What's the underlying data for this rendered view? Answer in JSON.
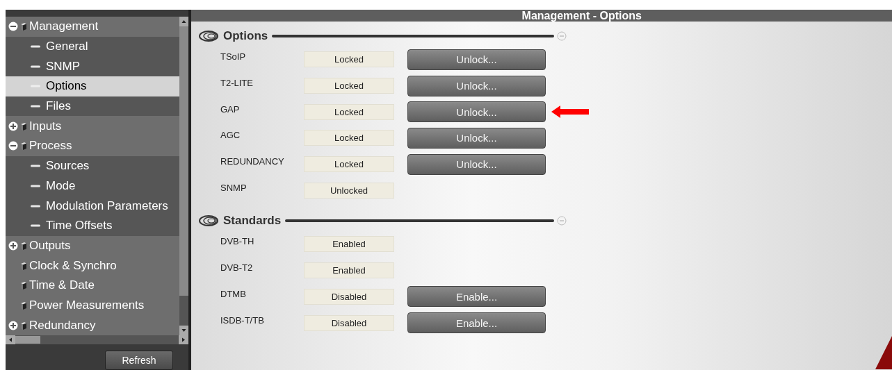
{
  "header": {
    "title": "Management - Options"
  },
  "tree": [
    {
      "label": "Management",
      "expanded": true,
      "selected": false,
      "children": [
        {
          "label": "General",
          "selected": false
        },
        {
          "label": "SNMP",
          "selected": false
        },
        {
          "label": "Options",
          "selected": true
        },
        {
          "label": "Files",
          "selected": false
        }
      ]
    },
    {
      "label": "Inputs",
      "expanded": false,
      "selected": false
    },
    {
      "label": "Process",
      "expanded": true,
      "selected": false,
      "children": [
        {
          "label": "Sources",
          "selected": false
        },
        {
          "label": "Mode",
          "selected": false
        },
        {
          "label": "Modulation Parameters",
          "selected": false
        },
        {
          "label": "Time Offsets",
          "selected": false
        }
      ]
    },
    {
      "label": "Outputs",
      "expanded": false,
      "selected": false
    },
    {
      "label": "Clock & Synchro",
      "selected": false
    },
    {
      "label": "Time & Date",
      "selected": false
    },
    {
      "label": "Power Measurements",
      "selected": false
    },
    {
      "label": "Redundancy",
      "expanded": false,
      "selected": false
    }
  ],
  "refresh_button": "Refresh",
  "sections": [
    {
      "title": "Options",
      "rows": [
        {
          "label": "TSoIP",
          "status": "Locked",
          "button": "Unlock...",
          "pointer_arrow": false
        },
        {
          "label": "T2-LITE",
          "status": "Locked",
          "button": "Unlock...",
          "pointer_arrow": false
        },
        {
          "label": "GAP",
          "status": "Locked",
          "button": "Unlock...",
          "pointer_arrow": true
        },
        {
          "label": "AGC",
          "status": "Locked",
          "button": "Unlock...",
          "pointer_arrow": false
        },
        {
          "label": "REDUNDANCY",
          "status": "Locked",
          "button": "Unlock...",
          "pointer_arrow": false
        },
        {
          "label": "SNMP",
          "status": "Unlocked",
          "pointer_arrow": false
        }
      ]
    },
    {
      "title": "Standards",
      "rows": [
        {
          "label": "DVB-TH",
          "status": "Enabled",
          "pointer_arrow": false
        },
        {
          "label": "DVB-T2",
          "status": "Enabled",
          "pointer_arrow": false
        },
        {
          "label": "DTMB",
          "status": "Disabled",
          "button": "Enable...",
          "pointer_arrow": false
        },
        {
          "label": "ISDB-T/TB",
          "status": "Disabled",
          "button": "Enable...",
          "pointer_arrow": false
        }
      ]
    }
  ]
}
